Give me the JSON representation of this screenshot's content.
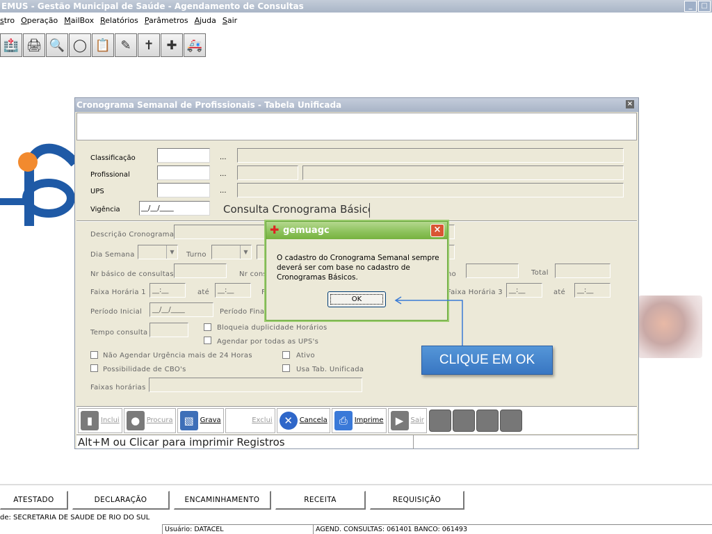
{
  "app": {
    "title": "EMUS - Gestão Municipal de Saúde - Agendamento de Consultas",
    "window_buttons": [
      "_",
      "□"
    ]
  },
  "menu": [
    "stro",
    "Operação",
    "MailBox",
    "Relatórios",
    "Parâmetros",
    "Ajuda",
    "Sair"
  ],
  "toolbar_icons": [
    "hospital-icon",
    "printer-icon",
    "magnifier-icon",
    "pill-icon",
    "clipboard-icon",
    "syringe-icon",
    "cross-icon",
    "medkit-icon",
    "ambulance-icon"
  ],
  "window": {
    "title": "Cronograma Semanal de Profissionais - Tabela Unificada",
    "close": "×",
    "labels": {
      "classificacao": "Classificação",
      "profissional": "Profissional",
      "ups": "UPS",
      "vigencia": "Vigência",
      "descricao": "Descrição Cronograma",
      "dia_semana": "Dia Semana",
      "turno": "Turno",
      "nr_basico": "Nr básico de consultas",
      "nr_cons": "Nr cons",
      "no": "no",
      "total": "Total",
      "faixa1": "Faixa Horária 1",
      "ate1": "até",
      "f": "F",
      "faixa3": "Faixa Horária 3",
      "ate3": "até",
      "periodo_inicial": "Período Inicial",
      "periodo_final": "Período Fina",
      "tempo_consulta": "Tempo consulta",
      "bloqueia": "Bloqueia duplicidade Horários",
      "agendar_todas": "Agendar por todas as UPS's",
      "nao_agendar": "Não Agendar Urgência mais de 24 Horas",
      "ativo": "Ativo",
      "possibilidade": "Possibilidade de CBO's",
      "usa_tab": "Usa Tab. Unificada",
      "faixas": "Faixas horárias"
    },
    "values": {
      "dots": "...",
      "vigencia": "__/__/____",
      "periodo_inicial": "__/__/____",
      "time_blank": "__:__"
    },
    "consulta_button": "Consulta Cronograma Básico",
    "buttons": {
      "inclui": "Inclui",
      "procura": "Procura",
      "grava": "Grava",
      "exclui": "Exclui",
      "cancela": "Cancela",
      "imprime": "Imprime",
      "sair": "Sair"
    },
    "status_text": "Alt+M ou Clicar para imprimir Registros"
  },
  "msgbox": {
    "title": "gemuagc",
    "close": "×",
    "text": "O cadastro do Cronograma Semanal sempre deverá ser com base no cadastro de Cronogramas Básicos.",
    "ok": "OK"
  },
  "callout": {
    "text": "CLIQUE EM OK",
    "color": "#4a88cf"
  },
  "bottom": {
    "tabs": [
      "ATESTADO",
      "DECLARAÇÃO",
      "ENCAMINHAMENTO",
      "RECEITA",
      "REQUISIÇÃO"
    ],
    "unit": "de: SECRETARIA DE SAUDE DE RIO DO SUL",
    "usuario": "Usuário: DATACEL",
    "agend": "AGEND. CONSULTAS: 061401 BANCO: 061493"
  }
}
